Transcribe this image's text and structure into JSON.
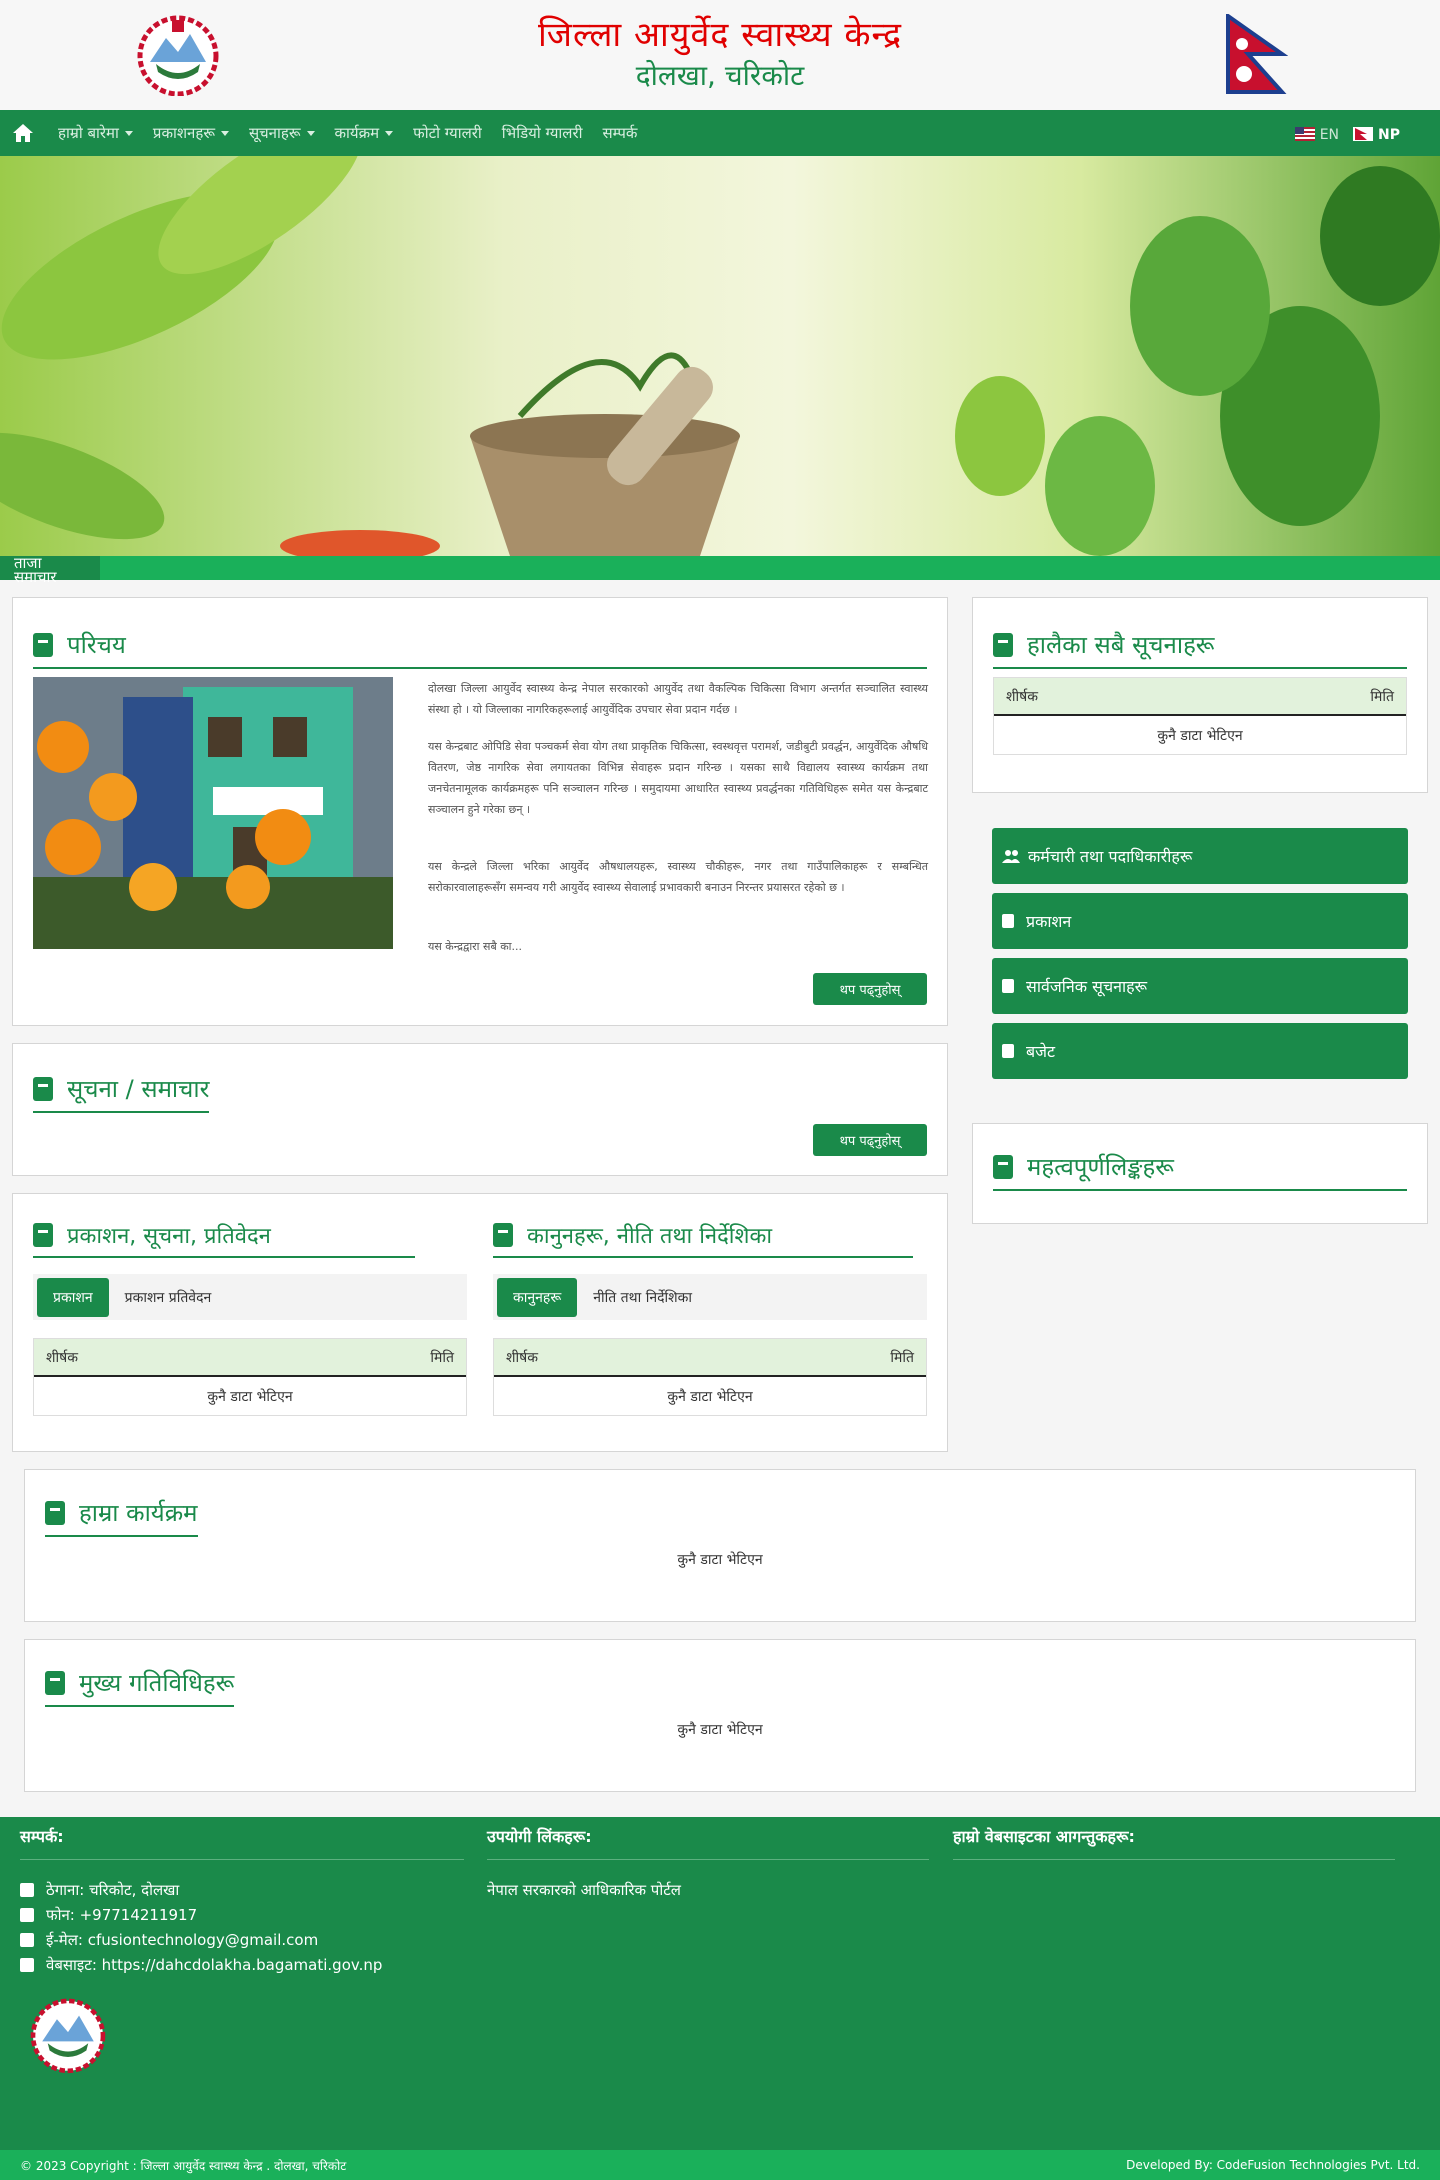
{
  "header": {
    "title": "जिल्ला आयुर्वेद स्वास्थ्य केन्द्र",
    "subtitle": "दोलखा, चरिकोट"
  },
  "nav": {
    "items": [
      {
        "label": "हाम्रो बारेमा",
        "dropdown": true
      },
      {
        "label": "प्रकाशनहरू",
        "dropdown": true
      },
      {
        "label": "सूचनाहरू",
        "dropdown": true
      },
      {
        "label": "कार्यक्रम",
        "dropdown": true
      },
      {
        "label": "फोटो ग्यालरी",
        "dropdown": false
      },
      {
        "label": "भिडियो ग्यालरी",
        "dropdown": false
      },
      {
        "label": "सम्पर्क",
        "dropdown": false
      }
    ],
    "lang_en": "EN",
    "lang_np": "NP"
  },
  "ticker": {
    "label": "ताजा समाचार"
  },
  "intro": {
    "heading": "परिचय",
    "para1": "दोलखा जिल्ला आयुर्वेद स्वास्थ्य केन्द्र नेपाल सरकारको आयुर्वेद तथा वैकल्पिक चिकित्सा विभाग अन्तर्गत सञ्चालित स्वास्थ्य संस्था हो । यो जिल्लाका नागरिकहरूलाई आयुर्वेदिक उपचार सेवा प्रदान गर्दछ ।",
    "para2": "यस केन्द्रबाट ओपिडि सेवा पञ्चकर्म सेवा योग तथा प्राकृतिक चिकित्सा, स्वस्थवृत्त परामर्श, जडीबुटी प्रवर्द्धन, आयुर्वेदिक औषधि वितरण, जेष्ठ नागरिक सेवा लगायतका विभिन्न सेवाहरू प्रदान गरिन्छ । यसका साथै विद्यालय स्वास्थ्य कार्यक्रम तथा जनचेतनामूलक कार्यक्रमहरू पनि सञ्चालन गरिन्छ । समुदायमा आधारित स्वास्थ्य प्रवर्द्धनका गतिविधिहरू समेत यस केन्द्रबाट सञ्चालन हुने गरेका छन् ।",
    "para3": "यस केन्द्रले जिल्ला भरिका आयुर्वेद औषधालयहरू, स्वास्थ्य चौकीहरू, नगर तथा गाउँपालिकाहरू र सम्बन्धित सरोकारवालाहरूसँग समन्वय गरी आयुर्वेद स्वास्थ्य सेवालाई प्रभावकारी बनाउन निरन्तर प्रयासरत रहेको छ ।",
    "para4": "यस केन्द्रद्वारा सबै का...",
    "more": "थप पढ्नुहोस्"
  },
  "notice": {
    "heading": "सूचना / समाचार",
    "more": "थप पढ्नुहोस्"
  },
  "publications": {
    "heading": "प्रकाशन, सूचना, प्रतिवेदन",
    "filter_button": "प्रकाशन",
    "filter_text": "प्रकाशन प्रतिवेदन",
    "col_title": "शीर्षक",
    "col_date": "मिति",
    "empty": "कुनै डाटा भेटिएन"
  },
  "downloads": {
    "heading": "कानुनहरू, नीति तथा निर्देशिका",
    "filter_button": "कानुनहरू",
    "filter_text": "नीति तथा निर्देशिका",
    "col_title": "शीर्षक",
    "col_date": "मिति",
    "empty": "कुनै डाटा भेटिएन"
  },
  "sidebar": {
    "recent": {
      "heading": "हालैका सबै सूचनाहरू",
      "col_title": "शीर्षक",
      "col_date": "मिति",
      "empty": "कुनै डाटा भेटिएन"
    },
    "buttons": [
      {
        "label": "कर्मचारी तथा पदाधिकारीहरू",
        "icon": "users-icon"
      },
      {
        "label": "प्रकाशन",
        "icon": "book-icon"
      },
      {
        "label": "सार्वजनिक सूचनाहरू",
        "icon": "book-icon"
      },
      {
        "label": "बजेट",
        "icon": "book-icon"
      }
    ],
    "links": {
      "heading": "महत्वपूर्णलिङ्कहरू"
    }
  },
  "programs": {
    "heading": "हाम्रा कार्यक्रम",
    "empty": "कुनै डाटा भेटिएन"
  },
  "activities": {
    "heading": "मुख्य गतिविधिहरू",
    "empty": "कुनै डाटा भेटिएन"
  },
  "footer": {
    "contact_heading": "सम्पर्क:",
    "address": "ठेगाना: चरिकोट, दोलखा",
    "phone": "फोन: +97714211917",
    "email": "ई-मेल: cfusiontechnology@gmail.com",
    "website": "वेबसाइट: https://dahcdolakha.bagamati.gov.np",
    "links_heading": "उपयोगी लिंकहरू:",
    "link1": "नेपाल सरकारको आधिकारिक पोर्टल",
    "visitors_heading": "हाम्रो वेबसाइटका आगन्तुकहरू:",
    "copyright": "© 2023 Copyright : जिल्ला आयुर्वेद स्वास्थ्य केन्द्र . दोलखा, चरिकोट",
    "developer": "Developed By: CodeFusion Technologies Pvt. Ltd."
  },
  "colors": {
    "primary": "#1a8a4a",
    "accent": "#1ab05a",
    "title_red": "#e00000",
    "table_head": "#e2f2dc"
  }
}
